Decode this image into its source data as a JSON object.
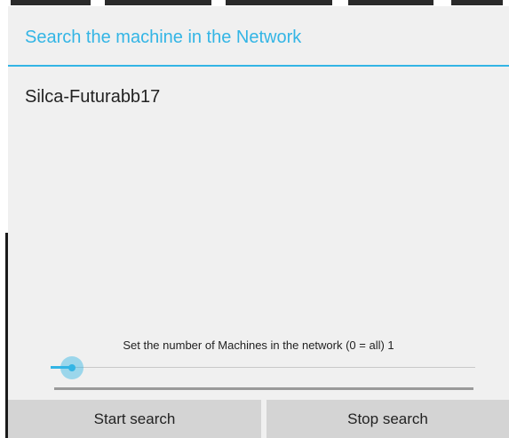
{
  "dialog": {
    "title": "Search the machine in the Network"
  },
  "machines": [
    {
      "name": "Silca-Futurabb17"
    }
  ],
  "machine_count": {
    "label": "Set the number of Machines in the network (0 = all) 1",
    "value": 1,
    "slider_fraction": 0.05
  },
  "buttons": {
    "start_label": "Start search",
    "stop_label": "Stop search"
  },
  "colors": {
    "accent": "#33b5e5",
    "dialog_background": "#f0f0f0",
    "button_background": "#d4d4d4",
    "text": "#222222"
  }
}
